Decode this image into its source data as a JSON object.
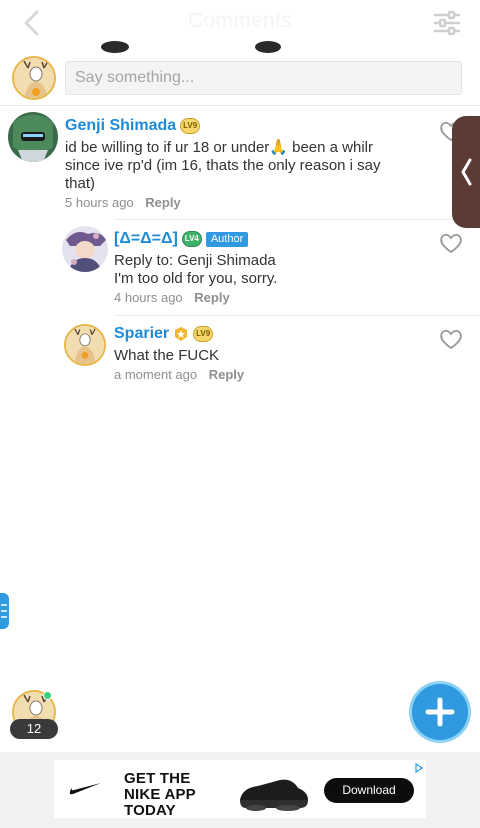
{
  "header": {
    "title": "Comments",
    "back_icon": "chevron-left-icon",
    "settings_icon": "sliders-icon"
  },
  "compose": {
    "placeholder": "Say something..."
  },
  "comments": [
    {
      "name": "Genji Shimada",
      "level": "LV9",
      "text": "id be willing to if ur 18 or under🙏 been a whilr since ive rp'd (im 16, thats the only reason i say that)",
      "time": "5 hours ago",
      "reply": "Reply"
    },
    {
      "name": "[Δ=Δ=Δ]",
      "level": "LV4",
      "author_badge": "Author",
      "text": "Reply to: Genji Shimada\nI'm too old for you, sorry.",
      "time": "4 hours ago",
      "reply": "Reply"
    },
    {
      "name": "Sparier",
      "level": "LV9",
      "text": "What the FUCK",
      "time": "a moment ago",
      "reply": "Reply"
    }
  ],
  "me": {
    "count": "12"
  },
  "ad": {
    "title": "GET THE NIKE APP TODAY",
    "button": "Download"
  },
  "colors": {
    "accent": "#2f9ae0",
    "username": "#1f8bd6"
  }
}
